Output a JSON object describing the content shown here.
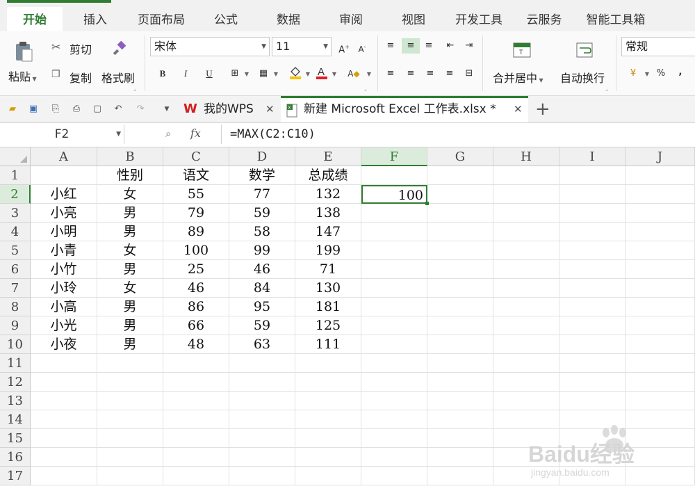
{
  "ribbon_tabs": [
    "开始",
    "插入",
    "页面布局",
    "公式",
    "数据",
    "审阅",
    "视图",
    "开发工具",
    "云服务",
    "智能工具箱"
  ],
  "clipboard": {
    "paste": "粘贴",
    "cut": "剪切",
    "copy": "复制",
    "format_painter": "格式刷"
  },
  "font": {
    "name": "宋体",
    "size": "11",
    "bold": "B",
    "italic": "I",
    "underline": "U"
  },
  "alignment": {
    "merge_center": "合并居中",
    "wrap_text": "自动换行"
  },
  "number": {
    "format": "常规",
    "percent": "%",
    "comma": ","
  },
  "document_tabs": {
    "wps": "我的WPS",
    "excel": "新建 Microsoft Excel 工作表.xlsx *",
    "add": "+"
  },
  "formula_bar": {
    "name_box": "F2",
    "fx": "fx",
    "formula": "=MAX(C2:C10)"
  },
  "columns": [
    "A",
    "B",
    "C",
    "D",
    "E",
    "F",
    "G",
    "H",
    "I",
    "J"
  ],
  "rows": [
    "1",
    "2",
    "3",
    "4",
    "5",
    "6",
    "7",
    "8",
    "9",
    "10",
    "11",
    "12",
    "13",
    "14",
    "15",
    "16",
    "17"
  ],
  "selected_cell": "F2",
  "table": {
    "headers": [
      "",
      "性别",
      "语文",
      "数学",
      "总成绩"
    ],
    "data": [
      [
        "小红",
        "女",
        "55",
        "77",
        "132"
      ],
      [
        "小亮",
        "男",
        "79",
        "59",
        "138"
      ],
      [
        "小明",
        "男",
        "89",
        "58",
        "147"
      ],
      [
        "小青",
        "女",
        "100",
        "99",
        "199"
      ],
      [
        "小竹",
        "男",
        "25",
        "46",
        "71"
      ],
      [
        "小玲",
        "女",
        "46",
        "84",
        "130"
      ],
      [
        "小高",
        "男",
        "86",
        "95",
        "181"
      ],
      [
        "小光",
        "男",
        "66",
        "59",
        "125"
      ],
      [
        "小夜",
        "男",
        "48",
        "63",
        "111"
      ]
    ],
    "result_value": "100"
  },
  "watermark": {
    "brand": "Baidu经验",
    "url": "jingyan.baidu.com"
  },
  "colors": {
    "accent": "#2f7d32",
    "header_bg": "#f0f0f0",
    "selected_header_bg": "#dcecdc"
  }
}
